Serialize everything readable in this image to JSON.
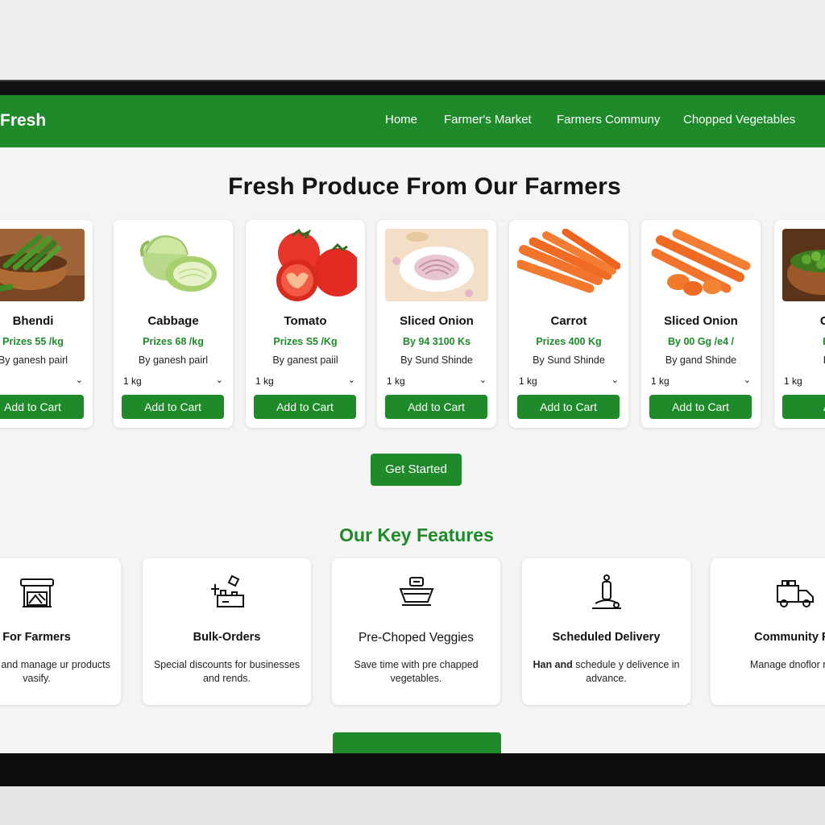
{
  "brand": {
    "name": "Fresh"
  },
  "nav": {
    "links": [
      "Home",
      "Farmer's Market",
      "Farmers Communy",
      "Chopped Vegetables"
    ]
  },
  "hero": {
    "title": "Fresh Produce From Our Farmers"
  },
  "products": [
    {
      "name": "Bhendi",
      "price": "Prizes 55 /kg",
      "farmer": "By ganesh pairl",
      "qty": "kg",
      "button": "Add to Cart",
      "image": "okra-bowl"
    },
    {
      "name": "Cabbage",
      "price": "Prizes 68 /kg",
      "farmer": "By ganesh pairl",
      "qty": "1 kg",
      "button": "Add to Cart",
      "image": "cabbage"
    },
    {
      "name": "Tomato",
      "price": "Prizes S5 /Kg",
      "farmer": "By ganest paiil",
      "qty": "1 kg",
      "button": "Add to Cart",
      "image": "tomatoes"
    },
    {
      "name": "Sliced Onion",
      "price": "By 94 3100 Ks",
      "farmer": "By Sund Shinde",
      "qty": "1 kg",
      "button": "Add to Cart",
      "image": "sliced-onion-plate"
    },
    {
      "name": "Carrot",
      "price": "Prizes 400 Kg",
      "farmer": "By Sund Shinde",
      "qty": "1 kg",
      "button": "Add to Cart",
      "image": "carrots"
    },
    {
      "name": "Sliced Onion",
      "price": "By 00 Gg /e4 /",
      "farmer": "By gand Shinde",
      "qty": "1 kg",
      "button": "Add to Cart",
      "image": "carrot-pieces"
    },
    {
      "name": "Gree",
      "price": "By S",
      "farmer": "By S",
      "qty": "1 kg",
      "button": "Add",
      "image": "green-peas-bowl"
    }
  ],
  "cta": {
    "label": "Get Started"
  },
  "features": {
    "title": "Our Key Features",
    "items": [
      {
        "title": "For Farmers",
        "desc": "nter isk, and manage ur products vasify.",
        "icon": "market-stall-icon"
      },
      {
        "title": "Bulk-Orders",
        "desc": "Special discounts for businesses and rends.",
        "icon": "bulk-order-icon"
      },
      {
        "title": "Pre-Choped Veggies",
        "desc": "Save time with pre chapped vegetables.",
        "icon": "chopping-bowl-icon"
      },
      {
        "title": "Scheduled Delivery",
        "desc_bold": "Han and",
        "desc": "schedule y delivence in advance.",
        "icon": "delivery-person-icon"
      },
      {
        "title": "Community Fe",
        "desc": "Manage dnoflor rele",
        "icon": "truck-icon"
      }
    ]
  },
  "colors": {
    "primary": "#1f8a2a",
    "background": "#f4f4f4",
    "card": "#ffffff",
    "text": "#141414"
  }
}
